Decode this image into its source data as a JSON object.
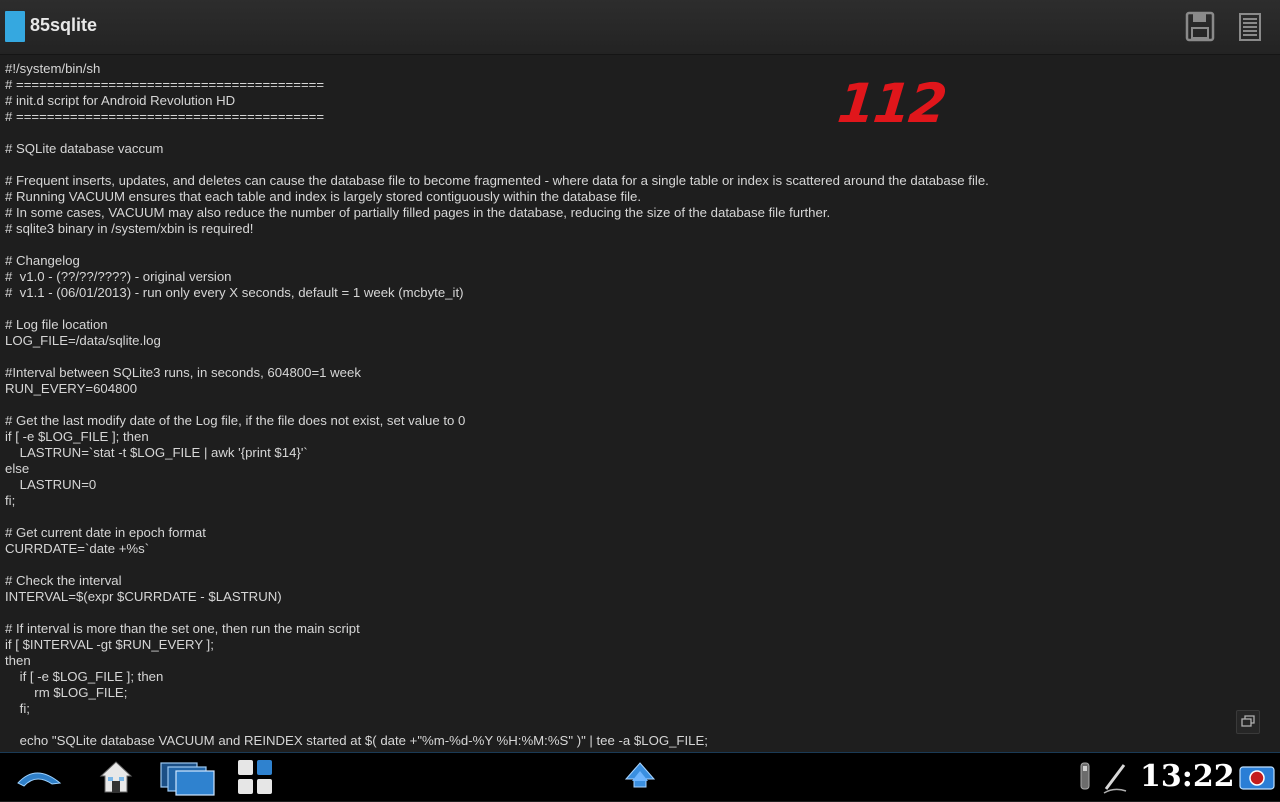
{
  "app": {
    "title": "85sqlite"
  },
  "editor": {
    "lines": [
      "#!/system/bin/sh",
      "# ========================================",
      "# init.d script for Android Revolution HD",
      "# ========================================",
      "",
      "# SQLite database vaccum",
      "",
      "# Frequent inserts, updates, and deletes can cause the database file to become fragmented - where data for a single table or index is scattered around the database file.",
      "# Running VACUUM ensures that each table and index is largely stored contiguously within the database file.",
      "# In some cases, VACUUM may also reduce the number of partially filled pages in the database, reducing the size of the database file further.",
      "# sqlite3 binary in /system/xbin is required!",
      "",
      "# Changelog",
      "#  v1.0 - (??/??/????) - original version",
      "#  v1.1 - (06/01/2013) - run only every X seconds, default = 1 week (mcbyte_it)",
      "",
      "# Log file location",
      "LOG_FILE=/data/sqlite.log",
      "",
      "#Interval between SQLite3 runs, in seconds, 604800=1 week",
      "RUN_EVERY=604800",
      "",
      "# Get the last modify date of the Log file, if the file does not exist, set value to 0",
      "if [ -e $LOG_FILE ]; then",
      "    LASTRUN=`stat -t $LOG_FILE | awk '{print $14}'`",
      "else",
      "    LASTRUN=0",
      "fi;",
      "",
      "# Get current date in epoch format",
      "CURRDATE=`date +%s`",
      "",
      "# Check the interval",
      "INTERVAL=$(expr $CURRDATE - $LASTRUN)",
      "",
      "# If interval is more than the set one, then run the main script",
      "if [ $INTERVAL -gt $RUN_EVERY ];",
      "then",
      "    if [ -e $LOG_FILE ]; then",
      "        rm $LOG_FILE;",
      "    fi;",
      "",
      "    echo \"SQLite database VACUUM and REINDEX started at $( date +\"%m-%d-%Y %H:%M:%S\" )\" | tee -a $LOG_FILE;"
    ]
  },
  "annotation": {
    "text": "112"
  },
  "status": {
    "clock": "13:22"
  },
  "icons": {
    "save": "save-icon",
    "menu": "menu-icon",
    "back": "back-icon",
    "home": "home-icon",
    "recent": "recent-apps-icon",
    "apps": "app-grid-icon",
    "up": "up-arrow-icon",
    "usb": "usb-icon",
    "stylus": "stylus-icon",
    "screenshot": "camera-icon",
    "restore": "window-restore-icon"
  },
  "colors": {
    "accent": "#35a8e0",
    "annotation": "#e0161b",
    "background": "#1e1e1e"
  }
}
